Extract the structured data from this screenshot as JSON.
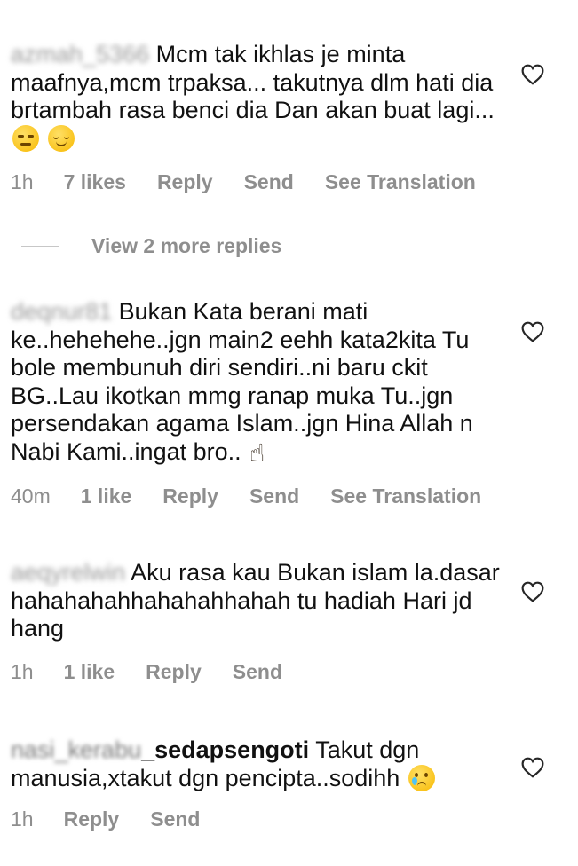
{
  "comments": [
    {
      "username": "azmah_5366",
      "text": "Mcm tak ikhlas je minta maafnya,mcm trpaksa... takutnya  dlm hati dia brtambah rasa benci dia Dan akan buat lagi...",
      "emojis": [
        "expressionless-face-emoji",
        "relieved-face-emoji"
      ],
      "time": "1h",
      "likes": "7 likes",
      "reply": "Reply",
      "send": "Send",
      "translate": "See Translation"
    },
    {
      "username": "deqnur81",
      "text": "Bukan Kata berani mati ke..hehehehe..jgn main2 eehh kata2kita Tu bole membunuh diri sendiri..ni baru ckit BG..Lau ikotkan mmg ranap muka Tu..jgn persendakan agama Islam..jgn Hina Allah n Nabi Kami..ingat bro..",
      "emojis": [
        "index-pointing-up-emoji"
      ],
      "time": "40m",
      "likes": "1 like",
      "reply": "Reply",
      "send": "Send",
      "translate": "See Translation"
    },
    {
      "username": "aeqyrelwin",
      "text": "Aku rasa kau Bukan islam la.dasar hahahahahhahahahhahah tu hadiah Hari jd hang",
      "time": "1h",
      "likes": "1 like",
      "reply": "Reply",
      "send": "Send"
    },
    {
      "username_visible": "_sedapsengoti",
      "username_blurred": "nasi_kerabu",
      "text": "Takut dgn manusia,xtakut dgn pencipta..sodihh",
      "emojis": [
        "crying-face-emoji"
      ],
      "time": "1h",
      "reply": "Reply",
      "send": "Send"
    }
  ],
  "view_replies": "View 2 more replies",
  "colors": {
    "text": "#111111",
    "meta": "#8e8e8e",
    "divider": "#c7c7c7"
  },
  "icons": {
    "like": "heart-outline-icon"
  }
}
